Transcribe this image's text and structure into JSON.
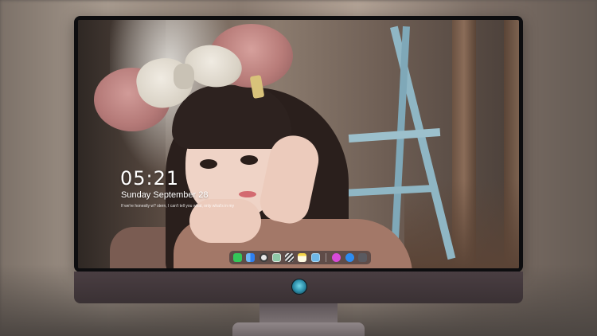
{
  "lockscreen": {
    "time": "05:21",
    "date": "Sunday September 28",
    "quote": "If we're honestly w? stern, I can't tell you what, only what's in my"
  },
  "dock": {
    "apps": [
      {
        "icon": "messages-icon",
        "color": "#34c759"
      },
      {
        "icon": "finder-icon",
        "color": "#2f7ff0"
      },
      {
        "icon": "safari-icon",
        "color": "#e8e8e8"
      },
      {
        "icon": "preview-icon",
        "color": "#8fc9a8"
      },
      {
        "icon": "clapper-icon",
        "color": "#3a3a3a"
      },
      {
        "icon": "notes-icon",
        "color": "#f5d547"
      },
      {
        "icon": "photos-icon",
        "color": "#6fb8e8"
      },
      {
        "icon": "itunes-icon",
        "color": "#d84bd8"
      },
      {
        "icon": "app-store-icon",
        "color": "#2d8cf0"
      },
      {
        "icon": "camera-icon",
        "color": "#5a5a60"
      }
    ]
  },
  "colors": {
    "monitor_bezel": "#0d0d0f",
    "monitor_chin": "#3a3134",
    "stand": "#7c7375",
    "logo_accent": "#2a8aa6"
  }
}
